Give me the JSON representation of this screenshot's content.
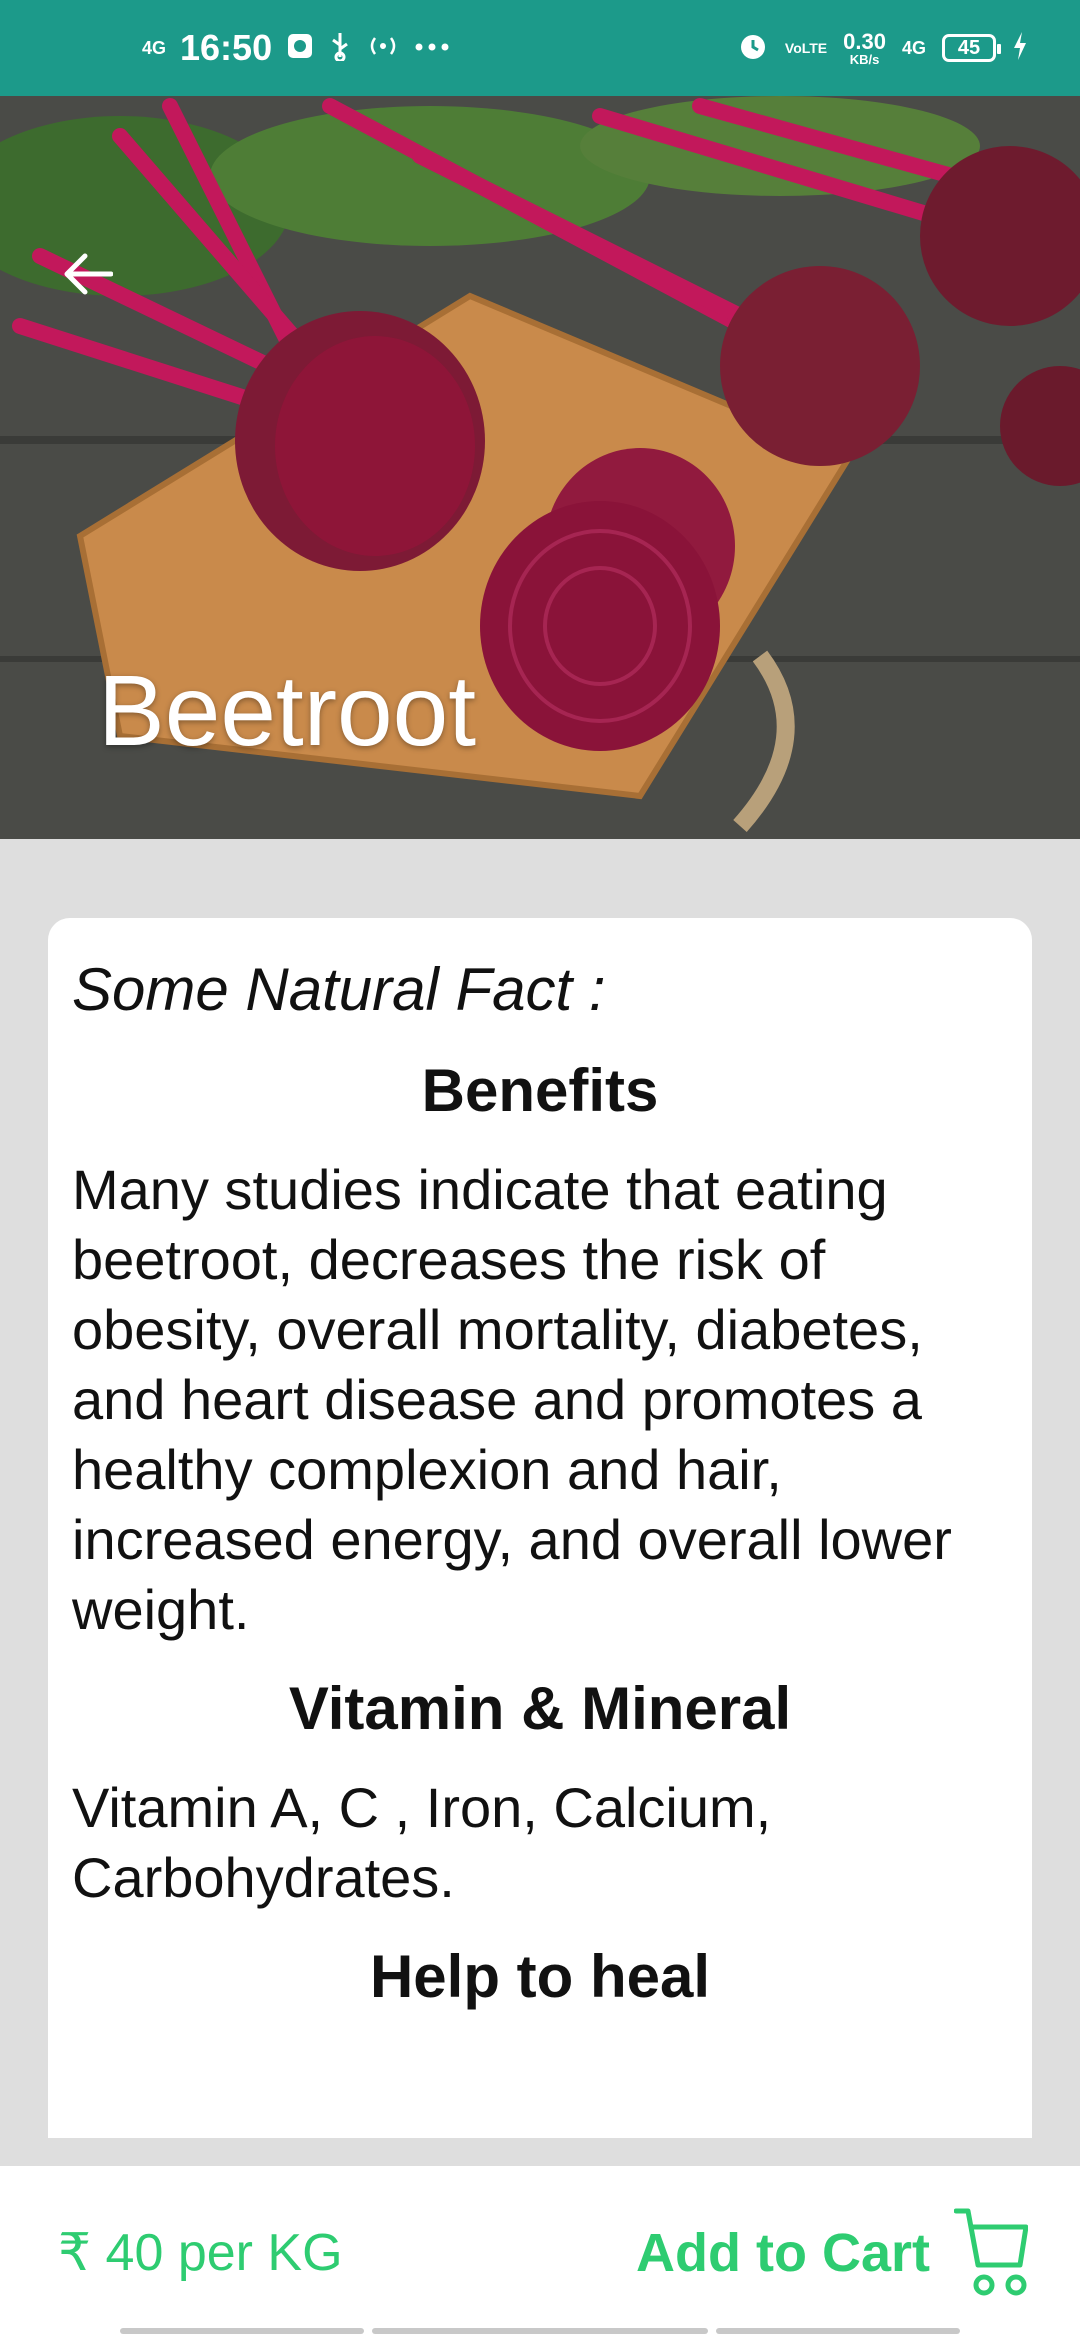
{
  "status_bar": {
    "network_left": "4G",
    "time": "16:50",
    "net_speed_value": "0.30",
    "net_speed_unit": "KB/s",
    "volte": "VoLTE",
    "network_right": "4G",
    "battery": "45"
  },
  "product": {
    "name": "Beetroot"
  },
  "card": {
    "facts_heading": "Some Natural Fact :",
    "benefits_title": "Benefits",
    "benefits_text": "Many studies indicate that eating beetroot, decreases the risk of obesity, overall mortality, diabetes, and heart disease and promotes a healthy complexion and hair, increased energy, and overall lower weight.",
    "vitamin_title": "Vitamin & Mineral",
    "vitamin_text": "Vitamin A, C , Iron, Calcium, Carbohydrates.",
    "heal_title": "Help to heal"
  },
  "bottom_bar": {
    "price": "₹ 40 per KG",
    "add_to_cart": "Add to Cart"
  },
  "colors": {
    "status_bar": "#1c9a8a",
    "accent_green": "#2ecc71",
    "background": "#dedede"
  }
}
